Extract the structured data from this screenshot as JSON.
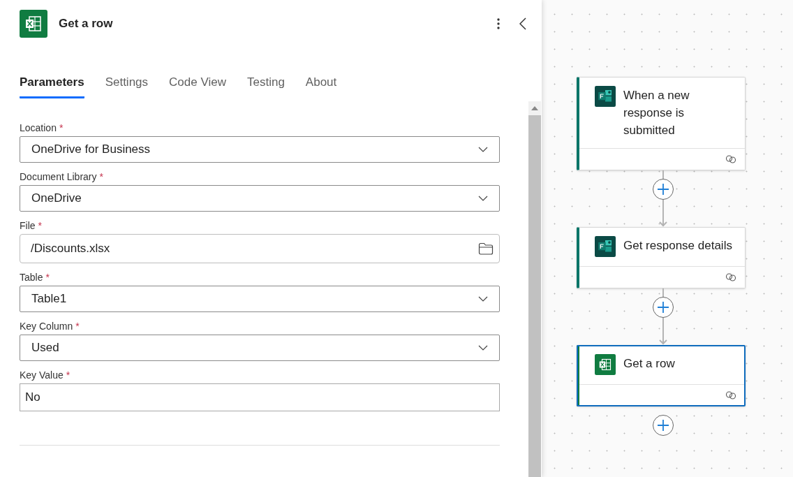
{
  "panel": {
    "title": "Get a row",
    "kind": "excel"
  },
  "tabs": [
    {
      "label": "Parameters",
      "selected": true
    },
    {
      "label": "Settings",
      "selected": false
    },
    {
      "label": "Code View",
      "selected": false
    },
    {
      "label": "Testing",
      "selected": false
    },
    {
      "label": "About",
      "selected": false
    }
  ],
  "fields": [
    {
      "label": "Location",
      "required_mark": "*",
      "kind": "dropdown",
      "value": "OneDrive for Business"
    },
    {
      "label": "Document Library",
      "required_mark": "*",
      "kind": "dropdown",
      "value": "OneDrive"
    },
    {
      "label": "File",
      "required_mark": "*",
      "kind": "file",
      "value": "/Discounts.xlsx"
    },
    {
      "label": "Table",
      "required_mark": "*",
      "kind": "dropdown",
      "value": "Table1"
    },
    {
      "label": "Key Column",
      "required_mark": "*",
      "kind": "dropdown",
      "value": "Used"
    },
    {
      "label": "Key Value",
      "required_mark": "*",
      "kind": "text",
      "value": "No"
    }
  ],
  "flow": [
    {
      "title": "When a new response is submitted",
      "kind": "forms",
      "selected": false
    },
    {
      "title": "Get response details",
      "kind": "forms",
      "selected": false
    },
    {
      "title": "Get a row",
      "kind": "excel",
      "selected": true
    }
  ]
}
